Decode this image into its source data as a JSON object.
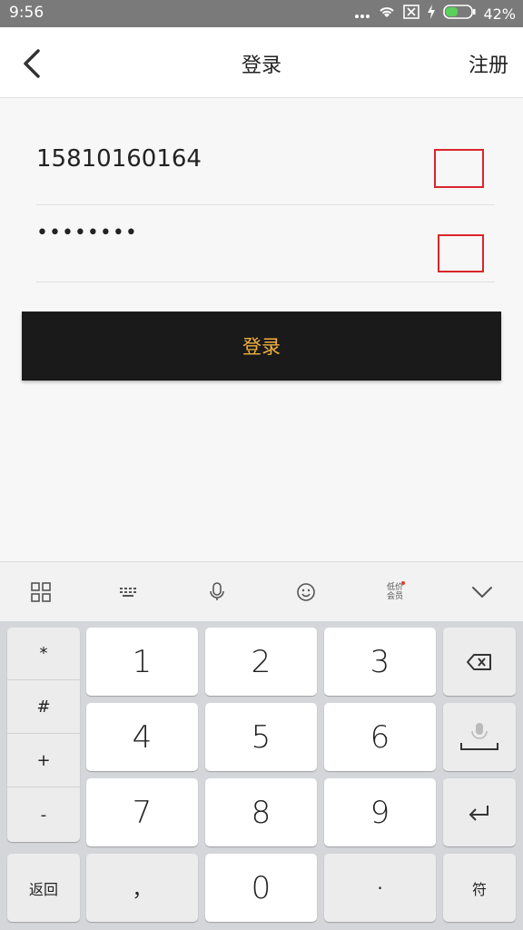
{
  "status_bar": {
    "time": "9:56",
    "battery": "42%"
  },
  "header": {
    "title": "登录",
    "right_action": "注册"
  },
  "form": {
    "phone_value": "15810160164",
    "password_value": "••••••••"
  },
  "login_button": "登录",
  "keyboard_toolbar": {
    "member_line1": "低价",
    "member_line2": "会员"
  },
  "keyboard": {
    "symbols": [
      "*",
      "#",
      "+",
      "-"
    ],
    "digits": [
      "1",
      "2",
      "3",
      "4",
      "5",
      "6",
      "7",
      "8",
      "9",
      "0"
    ],
    "back_key": "返回",
    "comma_key": "，",
    "dot_key": "·",
    "symbol_key": "符"
  },
  "colors": {
    "status_bar_bg": "#7a7a7a",
    "login_button_bg": "#1a1a1a",
    "login_button_text": "#f0b040",
    "highlight_box": "#d9262b"
  }
}
